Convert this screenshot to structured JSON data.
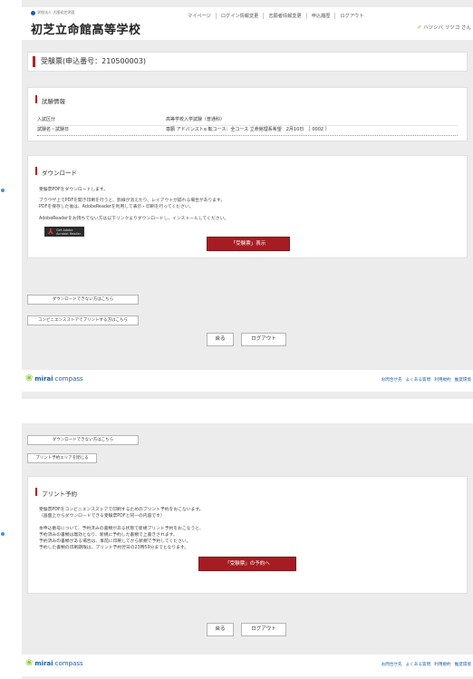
{
  "header": {
    "corp_name": "学校法人 大阪初芝学園",
    "school_name": "初芝立命館高等学校",
    "nav": [
      "マイページ",
      "ログイン情報変更",
      "志願者情報変更",
      "申込履歴",
      "ログアウト"
    ],
    "user_name": "ハツシバ リツコ さん"
  },
  "page_title": "受験票(申込番号：210500003)",
  "exam_info": {
    "title": "試験情報",
    "rows": [
      {
        "label": "入試区分",
        "value": "高等学校入学試験（普通科）"
      },
      {
        "label": "試験名・試験日",
        "value": "専願 アドバンストα 転コース：全コース 立命館理系希望　2月10日　［ 0002 ］"
      }
    ]
  },
  "download": {
    "title": "ダウンロード",
    "lines": [
      "受験票PDFをダウンロードします。",
      "ブラウザ上でPDFを開き印刷を行うと、罫線が消えたり、レイアウトが崩れる場合があります。",
      "PDFを保存した後は、AdobeReaderを利用して表示・印刷を行ってください。",
      "AdobeReaderをお持ちでない方は以下リンクよりダウンロードし、インストールしてください。"
    ],
    "adobe_line1": "Get Adobe",
    "adobe_line2": "Acrobat Reader",
    "show_button": "「受験票」表示"
  },
  "cant_download_button": "ダウンロードできない方はこちら",
  "convenience_button": "コンビニエンスストアでプリントする方はこちら",
  "close_print_area_button": "プリント予約エリアを閉じる",
  "back_button": "戻る",
  "logout_button": "ログアウト",
  "print": {
    "title": "プリント予約",
    "lines": [
      "受験票PDFをコンビニエンスストアで印刷するためのプリント予約をおこないます。",
      "（画面上からダウンロードできる受験票PDFと同一の内容です）",
      "本申込番号について、予約済みの書類がある状態で新規プリント予約をおこなうと、",
      "予約済みの書類は無効となり、新規に予約した書類で上書きされます。",
      "予約済みの書類がある場合は、事前に印刷してから新規で予約してください。",
      "予約した書類の印刷期限は、プリント予約翌日の23時59分までとなります。"
    ],
    "reserve_button": "「受験票」の予約へ"
  },
  "footer": {
    "logo_mirai": "mirai",
    "logo_compass": "compass",
    "links": [
      "お問合せ先",
      "よくある質問",
      "利用規約",
      "推奨環境"
    ]
  }
}
